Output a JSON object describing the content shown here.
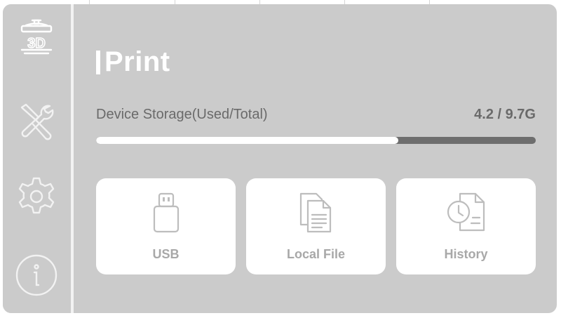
{
  "app": {
    "page_title": "Print",
    "sidebar": {
      "items": [
        {
          "id": "print",
          "icon": "printer-3d-icon",
          "icon_text": "3D"
        },
        {
          "id": "tools",
          "icon": "tools-icon"
        },
        {
          "id": "settings",
          "icon": "gear-icon"
        },
        {
          "id": "info",
          "icon": "info-icon"
        }
      ]
    }
  },
  "storage": {
    "label": "Device Storage(Used/Total)",
    "value_text": "4.2 / 9.7G",
    "used_fraction": 0.687
  },
  "sources": [
    {
      "label": "USB",
      "icon": "usb-drive-icon"
    },
    {
      "label": "Local File",
      "icon": "documents-icon"
    },
    {
      "label": "History",
      "icon": "history-clock-icon"
    }
  ],
  "colors": {
    "frame": "#cbcbcb",
    "text_muted": "#6a6a6a",
    "tile_label": "#a8a8a8",
    "progress_track": "#6e6e6e",
    "progress_fill": "#ffffff"
  }
}
